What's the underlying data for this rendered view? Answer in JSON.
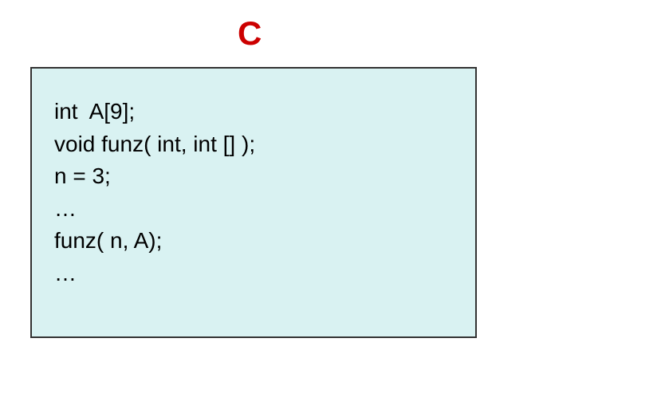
{
  "title": "C",
  "code": {
    "line1": "int  A[9];",
    "line2": "void funz( int, int [] );",
    "line3": "",
    "line4": "n = 3;",
    "line5": "…",
    "line6": "funz( n, A);",
    "line7": "…"
  }
}
